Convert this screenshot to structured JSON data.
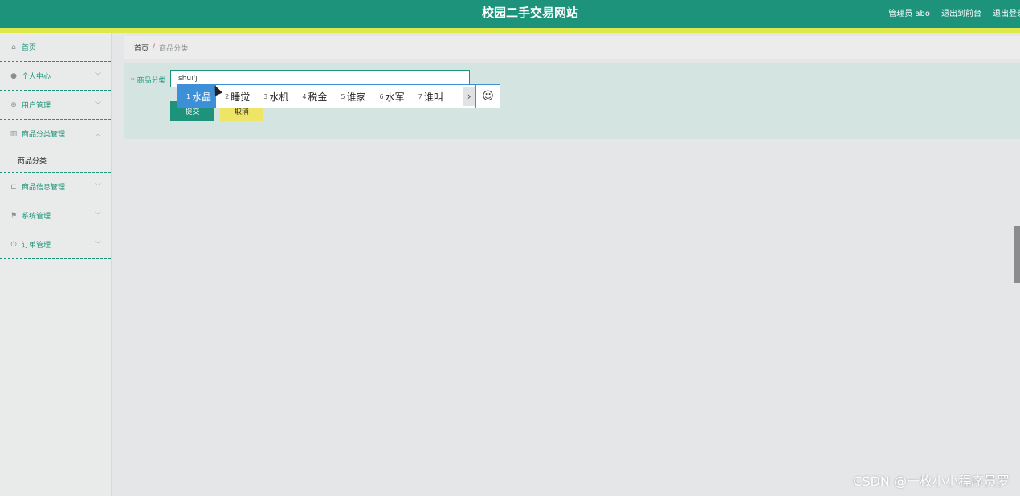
{
  "header": {
    "title": "校园二手交易网站",
    "admin_label": "管理员 abo",
    "front_link": "退出到前台",
    "logout_link": "退出登录"
  },
  "sidebar": {
    "items": [
      {
        "label": "首页",
        "icon": "home-icon"
      },
      {
        "label": "个人中心",
        "icon": "user-icon"
      },
      {
        "label": "用户管理",
        "icon": "users-icon"
      },
      {
        "label": "商品分类管理",
        "icon": "category-icon",
        "expanded": true,
        "sub": [
          "商品分类"
        ]
      },
      {
        "label": "商品信息管理",
        "icon": "crop-icon"
      },
      {
        "label": "系统管理",
        "icon": "flag-icon"
      },
      {
        "label": "订单管理",
        "icon": "power-icon"
      }
    ]
  },
  "breadcrumb": {
    "home": "首页",
    "sep": "/",
    "current": "商品分类"
  },
  "form": {
    "label": "商品分类",
    "required_mark": "*",
    "input_value": "shui'j",
    "submit_label": "提交",
    "cancel_label": "取消"
  },
  "ime": {
    "candidates": [
      {
        "n": "1",
        "text": "水晶"
      },
      {
        "n": "2",
        "text": "睡觉"
      },
      {
        "n": "3",
        "text": "水机"
      },
      {
        "n": "4",
        "text": "税金"
      },
      {
        "n": "5",
        "text": "谁家"
      },
      {
        "n": "6",
        "text": "水军"
      },
      {
        "n": "7",
        "text": "谁叫"
      }
    ],
    "next_glyph": "›",
    "emoji_glyph": "☺"
  },
  "watermark": "CSDN @一枚小小程序员罗",
  "colors": {
    "brand": "#1c937a",
    "accent": "#dfe84a",
    "ime_highlight": "#3d8fd8"
  }
}
